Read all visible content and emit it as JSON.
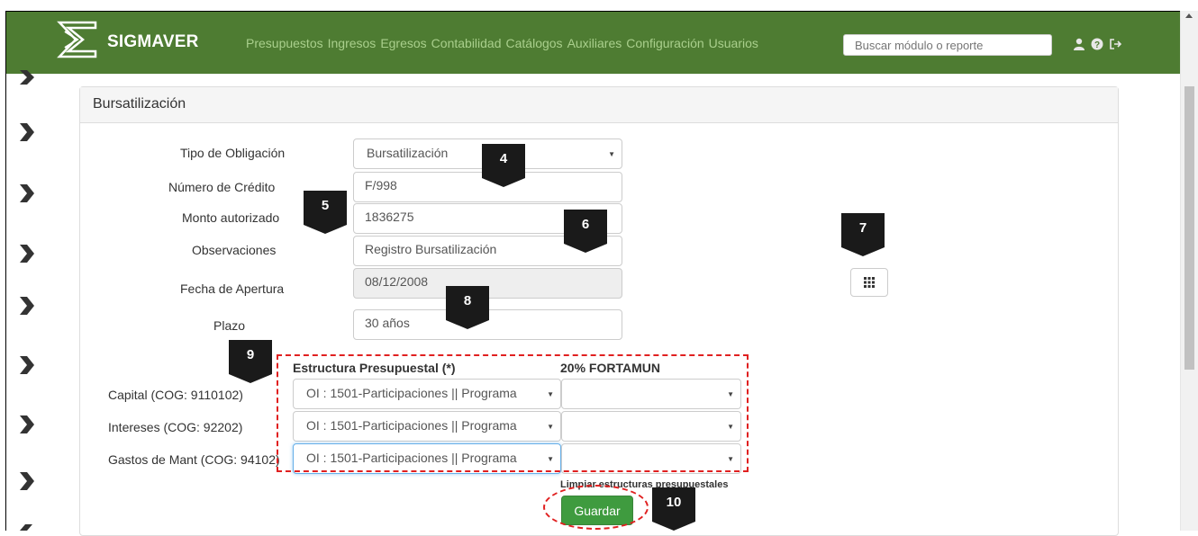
{
  "app": {
    "brand": "SIGMAVER",
    "menu": [
      "Presupuestos",
      "Ingresos",
      "Egresos",
      "Contabilidad",
      "Catálogos",
      "Auxiliares",
      "Configuración",
      "Usuarios"
    ],
    "search_placeholder": "Buscar módulo o reporte",
    "nav_icons": [
      "user-icon",
      "help-icon",
      "logout-icon"
    ],
    "colors": {
      "navbar": "#4e7c32",
      "menu_text": "#a9cf8c",
      "save_button": "#3f9b3f",
      "annotation": "#e02020"
    }
  },
  "panel": {
    "title": "Bursatilización",
    "form": {
      "tipo_label": "Tipo de Obligación",
      "tipo_value": "Bursatilización",
      "numero_label": "Número de Crédito",
      "numero_value": "F/998",
      "monto_label": "Monto autorizado",
      "monto_value": "1836275",
      "obs_label": "Observaciones",
      "obs_value": "Registro Bursatilización",
      "fecha_label": "Fecha de Apertura",
      "fecha_value": "08/12/2008",
      "plazo_label": "Plazo",
      "plazo_value": "30 años"
    },
    "estructura": {
      "col1_header": "Estructura Presupuestal (*)",
      "col2_header": "20% FORTAMUN",
      "rows": [
        {
          "label": "Capital (COG: 9110102)",
          "estructura": "OI : 1501-Participaciones || Programa",
          "fortamun": ""
        },
        {
          "label": "Intereses (COG: 92202)",
          "estructura": "OI : 1501-Participaciones || Programa",
          "fortamun": ""
        },
        {
          "label": "Gastos de Mant (COG: 94102)",
          "estructura": "OI : 1501-Participaciones || Programa",
          "fortamun": ""
        }
      ],
      "clear_link": "Limpiar estructuras presupuestales"
    },
    "save_label": "Guardar"
  },
  "markers": [
    "4",
    "5",
    "6",
    "7",
    "8",
    "9",
    "10"
  ]
}
